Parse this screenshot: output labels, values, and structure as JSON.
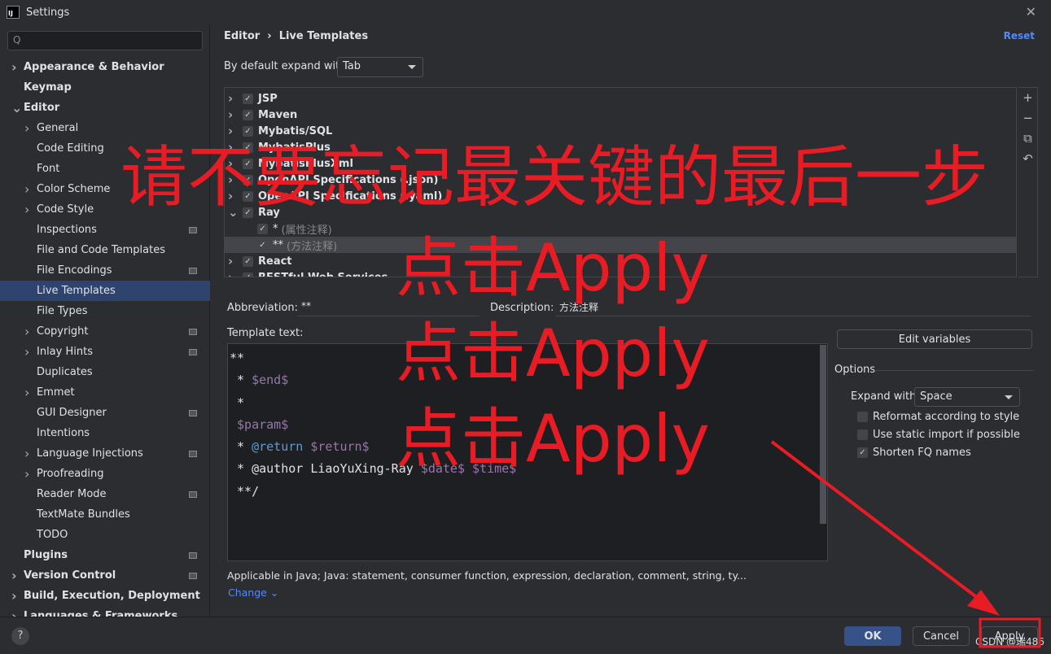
{
  "window": {
    "title": "Settings",
    "logo": "IJ"
  },
  "search": {
    "placeholder": "Q"
  },
  "sidebar": {
    "items": [
      {
        "label": "Appearance & Behavior",
        "level": 0,
        "arrow": "right",
        "bold": true
      },
      {
        "label": "Keymap",
        "level": 0,
        "bold": true
      },
      {
        "label": "Editor",
        "level": 0,
        "arrow": "down",
        "bold": true
      },
      {
        "label": "General",
        "level": 1,
        "arrow": "right"
      },
      {
        "label": "Code Editing",
        "level": 1
      },
      {
        "label": "Font",
        "level": 1
      },
      {
        "label": "Color Scheme",
        "level": 1,
        "arrow": "right"
      },
      {
        "label": "Code Style",
        "level": 1,
        "arrow": "right"
      },
      {
        "label": "Inspections",
        "level": 1,
        "gear": true
      },
      {
        "label": "File and Code Templates",
        "level": 1
      },
      {
        "label": "File Encodings",
        "level": 1,
        "gear": true
      },
      {
        "label": "Live Templates",
        "level": 1,
        "selected": true
      },
      {
        "label": "File Types",
        "level": 1
      },
      {
        "label": "Copyright",
        "level": 1,
        "arrow": "right",
        "gear": true
      },
      {
        "label": "Inlay Hints",
        "level": 1,
        "arrow": "right",
        "gear": true
      },
      {
        "label": "Duplicates",
        "level": 1
      },
      {
        "label": "Emmet",
        "level": 1,
        "arrow": "right"
      },
      {
        "label": "GUI Designer",
        "level": 1,
        "gear": true
      },
      {
        "label": "Intentions",
        "level": 1
      },
      {
        "label": "Language Injections",
        "level": 1,
        "arrow": "right",
        "gear": true
      },
      {
        "label": "Proofreading",
        "level": 1,
        "arrow": "right"
      },
      {
        "label": "Reader Mode",
        "level": 1,
        "gear": true
      },
      {
        "label": "TextMate Bundles",
        "level": 1
      },
      {
        "label": "TODO",
        "level": 1
      },
      {
        "label": "Plugins",
        "level": 0,
        "bold": true,
        "gear": true
      },
      {
        "label": "Version Control",
        "level": 0,
        "arrow": "right",
        "bold": true,
        "gear": true
      },
      {
        "label": "Build, Execution, Deployment",
        "level": 0,
        "arrow": "right",
        "bold": true
      },
      {
        "label": "Languages & Frameworks",
        "level": 0,
        "arrow": "right",
        "bold": true
      }
    ]
  },
  "breadcrumb": {
    "parent": "Editor",
    "separator": "›",
    "current": "Live Templates"
  },
  "reset": "Reset",
  "expand": {
    "label": "By default expand with",
    "value": "Tab"
  },
  "tree": {
    "rows": [
      {
        "label": "JSP",
        "group": true
      },
      {
        "label": "Maven",
        "group": true
      },
      {
        "label": "Mybatis/SQL",
        "group": true
      },
      {
        "label": "MybatisPlus",
        "group": true
      },
      {
        "label": "MybatisPlusXml",
        "group": true
      },
      {
        "label": "OpenAPI Specifications (.json)",
        "group": true
      },
      {
        "label": "OpenAPI Specifications (.yaml)",
        "group": true
      },
      {
        "label": "Ray",
        "group": true,
        "expanded": true
      },
      {
        "label": "*",
        "desc": "(属性注释)"
      },
      {
        "label": "**",
        "desc": "(方法注释)",
        "selected": true
      },
      {
        "label": "React",
        "group": true
      },
      {
        "label": "RESTful Web Services",
        "group": true
      }
    ],
    "toolbar": [
      "+",
      "−",
      "⧉",
      "↶"
    ]
  },
  "abbreviation": {
    "label": "Abbreviation:",
    "value": "**"
  },
  "description": {
    "label": "Description:",
    "value": "方法注释"
  },
  "template_text": {
    "label": "Template text:"
  },
  "edit_variables": "Edit variables",
  "options": {
    "title": "Options",
    "expand_label": "Expand with",
    "expand_value": "Space",
    "checks": [
      {
        "label": "Reformat according to style",
        "checked": false
      },
      {
        "label": "Use static import if possible",
        "checked": false
      },
      {
        "label": "Shorten FQ names",
        "checked": true
      }
    ]
  },
  "applicable": "Applicable in Java; Java: statement, consumer function, expression, declaration, comment, string, ty...",
  "change": "Change",
  "footer": {
    "help": "?",
    "ok": "OK",
    "cancel": "Cancel",
    "apply": "Apply",
    "watermark": "CSDN @瑞486"
  },
  "annotation": {
    "line1": "请不要忘记最关键的最后一步",
    "repeat": "点击Apply",
    "color": "#e81c24"
  }
}
